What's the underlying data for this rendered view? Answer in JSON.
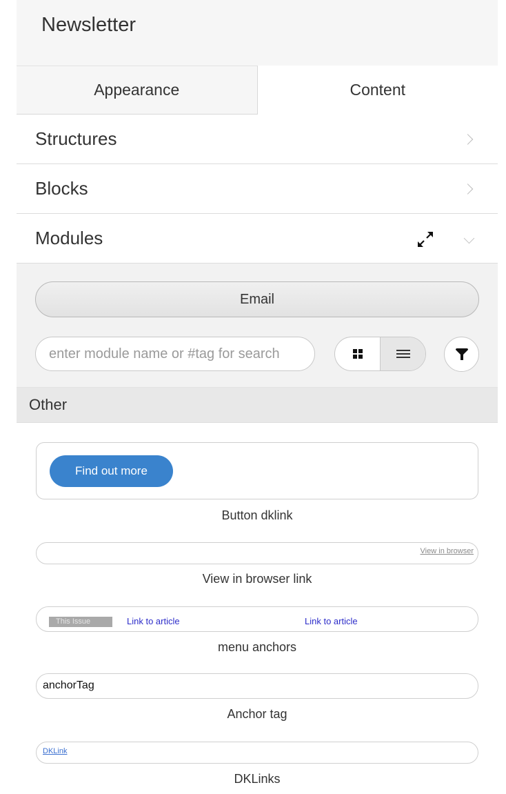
{
  "header": {
    "title": "Newsletter"
  },
  "tabs": [
    {
      "label": "Appearance"
    },
    {
      "label": "Content"
    }
  ],
  "accordion": {
    "structures": "Structures",
    "blocks": "Blocks",
    "modules": "Modules"
  },
  "modules": {
    "email_button": "Email",
    "search": {
      "placeholder": "enter module name or #tag for search"
    },
    "view_modes": [
      "grid",
      "list"
    ],
    "active_view": "list"
  },
  "section": {
    "title": "Other"
  },
  "items": {
    "button_dklink": {
      "preview_button": "Find out more",
      "caption": "Button dklink"
    },
    "view_in_browser": {
      "preview_text": "View in browser",
      "caption": "View in browser link"
    },
    "menu_anchors": {
      "issue_label": "This Issue",
      "link1": "Link to article",
      "link2": "Link to article",
      "caption": "menu anchors"
    },
    "anchor_tag": {
      "preview_text": "anchorTag",
      "caption": "Anchor tag"
    },
    "dklinks": {
      "preview_text": "DKLink",
      "caption": "DKLinks"
    }
  },
  "colors": {
    "accent": "#3a83cd",
    "link": "#2c2cc9",
    "section_bg": "#e8e8e8"
  }
}
